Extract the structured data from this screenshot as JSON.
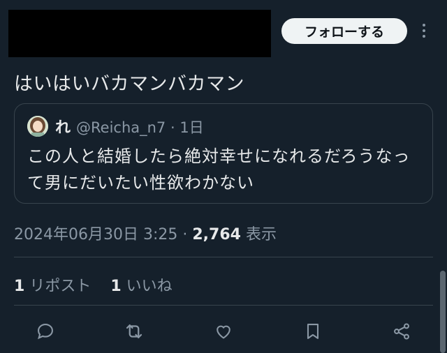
{
  "header": {
    "follow_label": "フォローする"
  },
  "tweet": {
    "text": "はいはいバカマンバカマン"
  },
  "quote": {
    "name": "れ",
    "handle": "@Reicha_n7",
    "time": "· 1日",
    "text": "この人と結婚したら絶対幸せになれるだろうなって男にだいたい性欲わかない"
  },
  "meta": {
    "datetime": "2024年06月30日 3:25",
    "separator": "·",
    "views_count": "2,764",
    "views_label": "表示"
  },
  "stats": {
    "reposts_count": "1",
    "reposts_label": "リポスト",
    "likes_count": "1",
    "likes_label": "いいね"
  },
  "actions": [
    "reply-icon",
    "repost-icon",
    "like-icon",
    "bookmark-icon",
    "share-icon"
  ],
  "colors": {
    "background": "#15202b",
    "text": "#e7e9ea",
    "muted": "#8b98a5",
    "border": "#38444d"
  }
}
